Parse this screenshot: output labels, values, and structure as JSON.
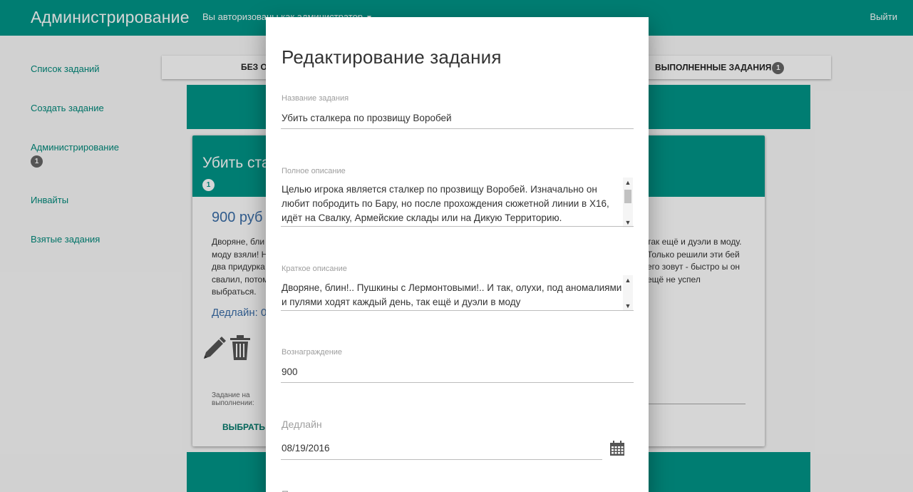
{
  "app": {
    "title": "Администрирование",
    "auth_text": "Вы авторизованы как администратор",
    "logout": "Выйти",
    "brand_color": "#009688"
  },
  "sidebar": {
    "items": [
      {
        "label": "Список заданий"
      },
      {
        "label": "Создать задание"
      },
      {
        "label": "Администрирование",
        "badge": "1"
      },
      {
        "label": "Инвайты"
      },
      {
        "label": "Взятые задания"
      }
    ]
  },
  "tabs": [
    {
      "label": "БЕЗ О"
    },
    {
      "label": "ВЫПОЛНЕННЫЕ ЗАДАНИЯ",
      "badge": "1"
    }
  ],
  "card": {
    "title": "Убить ста",
    "badge": "1",
    "price": "900 руб",
    "description_left": "Дворяне, бли моду взяли! Н два придурка свалил, потом выбраться.",
    "description_right": "так ещё и дуэли в моду. Только решили эти бей его зовут - быстро ы он ещё не успел",
    "deadline": "Дедлайн: 0",
    "status_label": "Задание на выполнении:",
    "choose_button": "ВЫБРАТЬ"
  },
  "modal": {
    "title": "Редактирование задания",
    "fields": {
      "name": {
        "label": "Название задания",
        "value": "Убить сталкера по прозвищу Воробей"
      },
      "full_description": {
        "label": "Полное описание",
        "value": "Целью игрока является сталкер по прозвищу Воробей. Изначально он любит побродить по Бару, но после прохождения сюжетной линии в Х16, идёт на Свалку, Армейские склады или на Дикую Территорию."
      },
      "short_description": {
        "label": "Краткое описание",
        "value": "Дворяне, блин!.. Пушкины с Лермонтовыми!.. И так, олухи, под аномалиями и пулями ходят каждый день, так ещё и дуэли в моду"
      },
      "reward": {
        "label": "Вознаграждение",
        "value": "900"
      },
      "deadline": {
        "label": "Дедлайн",
        "value": "08/19/2016"
      }
    },
    "icons": {
      "calendar": "calendar-icon",
      "edit": "pencil-icon",
      "delete": "trash-icon"
    }
  }
}
